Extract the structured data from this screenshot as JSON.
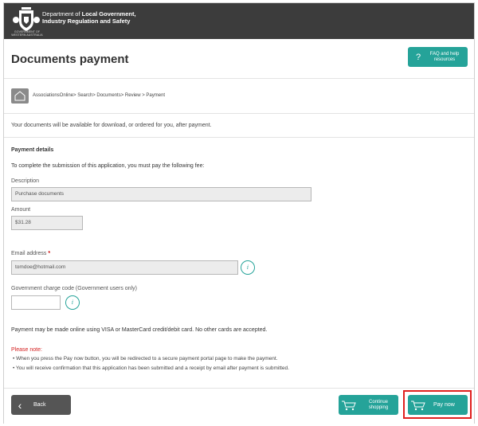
{
  "header": {
    "crest_caption": "GOVERNMENT OF WESTERN AUSTRALIA",
    "dept_prefix": "Department of ",
    "dept_bold_1": "Local Government,",
    "dept_line_2": "Industry Regulation and Safety"
  },
  "title": {
    "text": "Documents payment",
    "faq_label": "FAQ and help resources"
  },
  "breadcrumb": {
    "text": "AssociationsOnline> Search> Documents> Review > Payment"
  },
  "notice": "Your documents will be available for download, or ordered for you, after payment.",
  "payment": {
    "section_title": "Payment details",
    "instruction": "To complete the submission of this application, you must pay the following fee:",
    "description_label": "Description",
    "description_value": "Purchase documents",
    "amount_label": "Amount",
    "amount_value": "$31.28",
    "email_label": "Email address",
    "email_required": "*",
    "email_value": "tomdoe@hotmail.com",
    "gov_code_label": "Government charge code (Government users only)",
    "gov_code_value": "",
    "info_glyph": "i",
    "cards_info": "Payment may be made online using VISA or MasterCard credit/debit card. No other cards are accepted."
  },
  "note": {
    "heading": "Please note:",
    "lines": [
      "•  When you press the Pay now button, you will be redirected to a secure payment portal page to make the payment.",
      "•  You will receive confirmation that this application has been submitted and a receipt by email after payment is submitted."
    ]
  },
  "footer": {
    "back_label": "Back",
    "continue_label": "Continue shopping",
    "pay_label": "Pay now"
  },
  "colors": {
    "topbar": "#3c3c3c",
    "accent": "#25a399",
    "highlight": "#e0201e",
    "required": "#d42020"
  }
}
